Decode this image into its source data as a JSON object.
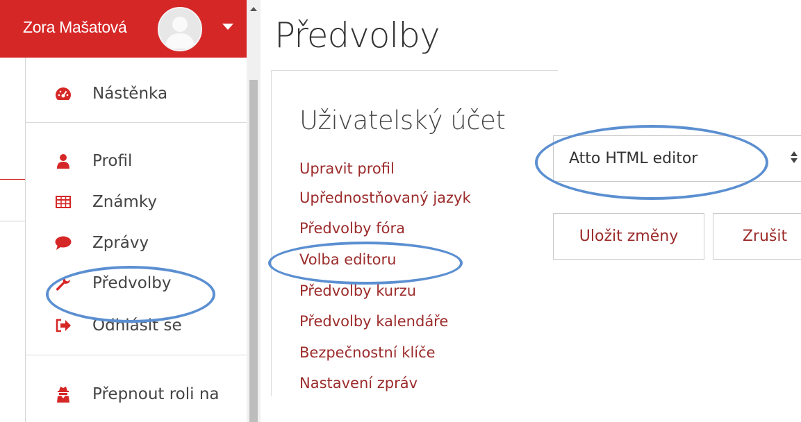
{
  "user_menu": {
    "username": "Zora Mašatová",
    "items": [
      {
        "label": "Nástěnka",
        "icon": "dashboard-icon"
      },
      {
        "label": "Profil",
        "icon": "user-icon"
      },
      {
        "label": "Známky",
        "icon": "table-icon"
      },
      {
        "label": "Zprávy",
        "icon": "comment-icon"
      },
      {
        "label": "Předvolby",
        "icon": "wrench-icon"
      },
      {
        "label": "Odhlásit se",
        "icon": "sign-out-icon"
      },
      {
        "label": "Přepnout roli na",
        "icon": "user-secret-icon"
      }
    ]
  },
  "preferences": {
    "title": "Předvolby",
    "section_title": "Uživatelský účet",
    "links": [
      "Upravit profil",
      "Upřednostňovaný jazyk",
      "Předvolby fóra",
      "Volba editoru",
      "Předvolby kurzu",
      "Předvolby kalendáře",
      "Bezpečnostní klíče",
      "Nastavení zpráv"
    ]
  },
  "editor_form": {
    "selected_editor": "Atto HTML editor",
    "save_label": "Uložit změny",
    "cancel_label": "Zrušit"
  },
  "colors": {
    "brand_red": "#d62727",
    "link_red": "#9c2b2b",
    "highlight_blue": "#5b8fd1"
  }
}
